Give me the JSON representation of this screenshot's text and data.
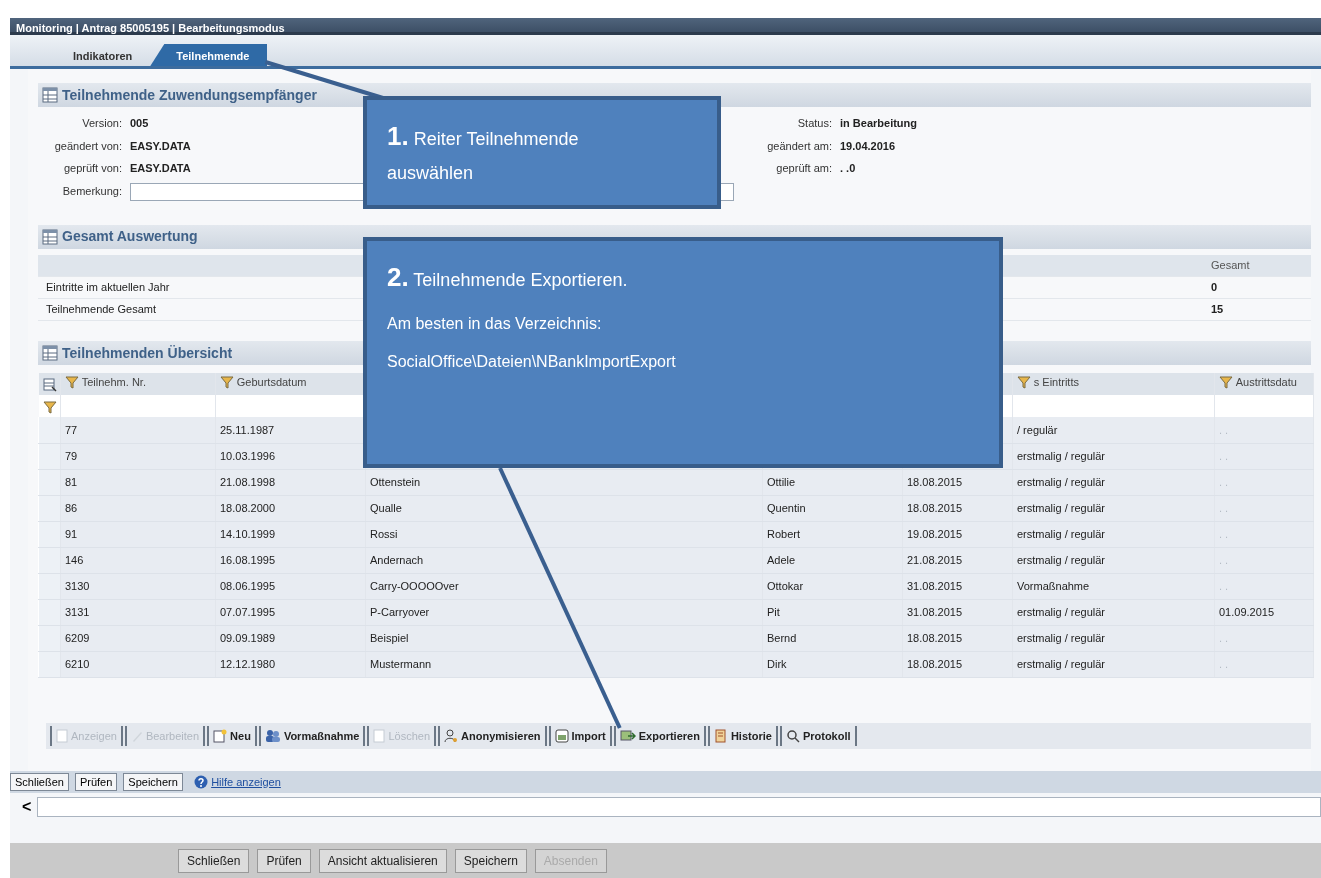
{
  "window": {
    "title": "Monitoring | Antrag 85005195 | Bearbeitungsmodus"
  },
  "tabs": [
    {
      "label": "Indikatoren",
      "selected": false
    },
    {
      "label": "Teilnehmende",
      "selected": true
    }
  ],
  "recipient": {
    "title": "Teilnehmende Zuwendungsempfänger",
    "fields_left": [
      {
        "label": "Version:",
        "value": "005"
      },
      {
        "label": "geändert von:",
        "value": "EASY.DATA"
      },
      {
        "label": "geprüft von:",
        "value": "EASY.DATA"
      }
    ],
    "fields_right": [
      {
        "label": "Status:",
        "value": "in Bearbeitung"
      },
      {
        "label": "geändert am:",
        "value": "19.04.2016"
      },
      {
        "label": "geprüft am:",
        "value": ". .0"
      }
    ],
    "remark": {
      "label": "Bemerkung:"
    }
  },
  "summary": {
    "title": "Gesamt Auswertung",
    "total_header": "Gesamt",
    "rows": [
      {
        "label": "Eintritte im aktuellen Jahr",
        "total": "0"
      },
      {
        "label": "Teilnehmende Gesamt",
        "total": "15"
      }
    ]
  },
  "overview": {
    "title": "Teilnehmenden Übersicht",
    "columns": {
      "nr": "Teilnehm. Nr.",
      "birth": "Geburtsdatum",
      "entry_type": "s Eintritts",
      "exit_date": "Austrittsdatu"
    },
    "rows": [
      {
        "nr": "77",
        "birth": "25.11.1987",
        "entry_type": "/ regulär",
        "exit_date": ". ."
      },
      {
        "nr": "79",
        "birth": "10.03.1996",
        "entry_type": "erstmalig / regulär",
        "exit_date": ". ."
      },
      {
        "nr": "81",
        "birth": "21.08.1998",
        "name": "Ottenstein",
        "first_name": "Ottilie",
        "entry_date": "18.08.2015",
        "entry_type": "erstmalig / regulär",
        "exit_date": ". ."
      },
      {
        "nr": "86",
        "birth": "18.08.2000",
        "name": "Qualle",
        "first_name": "Quentin",
        "entry_date": "18.08.2015",
        "entry_type": "erstmalig / regulär",
        "exit_date": ". ."
      },
      {
        "nr": "91",
        "birth": "14.10.1999",
        "name": "Rossi",
        "first_name": "Robert",
        "entry_date": "19.08.2015",
        "entry_type": "erstmalig / regulär",
        "exit_date": ". ."
      },
      {
        "nr": "146",
        "birth": "16.08.1995",
        "name": "Andernach",
        "first_name": "Adele",
        "entry_date": "21.08.2015",
        "entry_type": "erstmalig / regulär",
        "exit_date": ". ."
      },
      {
        "nr": "3130",
        "birth": "08.06.1995",
        "name": "Carry-OOOOOver",
        "first_name": "Ottokar",
        "entry_date": "31.08.2015",
        "entry_type": "Vormaßnahme",
        "exit_date": ". ."
      },
      {
        "nr": "3131",
        "birth": "07.07.1995",
        "name": "P-Carryover",
        "first_name": "Pit",
        "entry_date": "31.08.2015",
        "entry_type": "erstmalig / regulär",
        "exit_date": "01.09.2015"
      },
      {
        "nr": "6209",
        "birth": "09.09.1989",
        "name": "Beispiel",
        "first_name": "Bernd",
        "entry_date": "18.08.2015",
        "entry_type": "erstmalig / regulär",
        "exit_date": ". ."
      },
      {
        "nr": "6210",
        "birth": "12.12.1980",
        "name": "Mustermann",
        "first_name": "Dirk",
        "entry_date": "18.08.2015",
        "entry_type": "erstmalig / regulär",
        "exit_date": ". ."
      }
    ],
    "toolbar": [
      {
        "label": "Anzeigen",
        "disabled": true
      },
      {
        "label": "Bearbeiten",
        "disabled": true
      },
      {
        "label": "Neu",
        "disabled": false
      },
      {
        "label": "Vormaßnahme",
        "disabled": false
      },
      {
        "label": "Löschen",
        "disabled": true
      },
      {
        "label": "Anonymisieren",
        "disabled": false
      },
      {
        "label": "Import",
        "disabled": false
      },
      {
        "label": "Exportieren",
        "disabled": false
      },
      {
        "label": "Historie",
        "disabled": false
      },
      {
        "label": "Protokoll",
        "disabled": false
      }
    ]
  },
  "action_bar": {
    "buttons": [
      "Schließen",
      "Prüfen",
      "Speichern"
    ],
    "help_link": "Hilfe anzeigen",
    "scroll_button": "<"
  },
  "footer_buttons": [
    {
      "label": "Schließen",
      "disabled": false
    },
    {
      "label": "Prüfen",
      "disabled": false
    },
    {
      "label": "Ansicht aktualisieren",
      "disabled": false
    },
    {
      "label": "Speichern",
      "disabled": false
    },
    {
      "label": "Absenden",
      "disabled": true
    }
  ],
  "callouts": [
    {
      "text": "**1.** Reiter Teilnehmende auswählen"
    },
    {
      "text": "**2.** Teilnehmende Exportieren.",
      "lines": [
        "Am besten in das Verzeichnis:",
        "SocialOffice\\Dateien\\NBankImportExport"
      ]
    }
  ]
}
